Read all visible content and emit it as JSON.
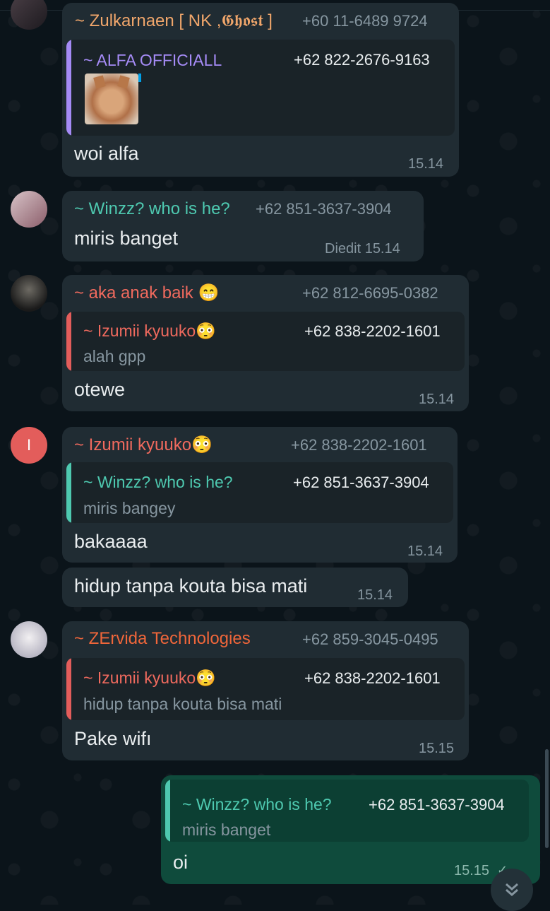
{
  "colors": {
    "green": "#53bdeb",
    "orange": "#f0a66b",
    "purple": "#a58bf6",
    "teal": "#4ec9b0",
    "red": "#e35d5b",
    "salmon": "#f06a5e"
  },
  "messages": [
    {
      "sender": "~ Zulkarnaen [ NK ,𝕲𝖍𝖔𝖘𝖙 ]",
      "phone": "+60 11-6489 9724",
      "quote": {
        "name": "~ ALFA OFFICIALL",
        "phone": "+62 822-2676-9163"
      },
      "text": "woi alfa",
      "time": "15.14"
    },
    {
      "sender": "~ Winzz? who is he?",
      "phone": "+62 851-3637-3904",
      "text": "miris banget",
      "time": "Diedit 15.14"
    },
    {
      "sender": "~ aka anak baik 😁",
      "phone": "+62 812-6695-0382",
      "quote": {
        "name": "~ Izumii kyuuko😳",
        "phone": "+62 838-2202-1601",
        "text": "alah gpp"
      },
      "text": "otewe",
      "time": "15.14"
    },
    {
      "avatar_letter": "I",
      "sender": "~ Izumii kyuuko😳",
      "phone": "+62 838-2202-1601",
      "quote": {
        "name": "~ Winzz? who is he?",
        "phone": "+62 851-3637-3904",
        "text": "miris bangey"
      },
      "text": "bakaaaa",
      "time": "15.14"
    },
    {
      "text": "hidup tanpa kouta bisa mati",
      "time": "15.14"
    },
    {
      "sender": "~ ZErvida Technologies",
      "phone": "+62 859-3045-0495",
      "quote": {
        "name": "~ Izumii kyuuko😳",
        "phone": "+62 838-2202-1601",
        "text": "hidup tanpa kouta bisa mati"
      },
      "text": "Pake wifı",
      "time": "15.15"
    },
    {
      "outgoing": true,
      "quote": {
        "name": "~ Winzz? who is he?",
        "phone": "+62 851-3637-3904",
        "text": "miris banget"
      },
      "text": "oi",
      "time": "15.15"
    }
  ],
  "scroll_down_icon": "double-chevron-down-icon"
}
